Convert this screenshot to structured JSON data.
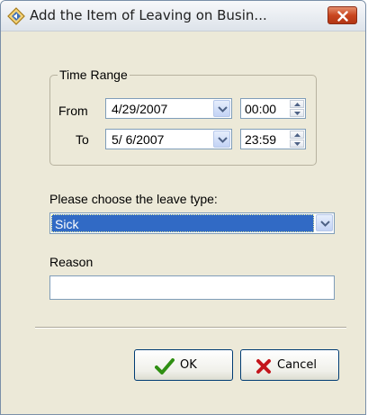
{
  "window": {
    "title": "Add the Item of Leaving on Busin..."
  },
  "time_range": {
    "legend": "Time Range",
    "from_label": "From",
    "to_label": "To",
    "from_date": "4/29/2007",
    "from_time": "00:00",
    "to_date": "5/ 6/2007",
    "to_time": "23:59"
  },
  "leave_type": {
    "label": "Please choose the leave type:",
    "selected": "Sick"
  },
  "reason": {
    "label": "Reason",
    "value": ""
  },
  "buttons": {
    "ok": "OK",
    "cancel": "Cancel"
  },
  "icons": {
    "app": "diamond-arrow-icon",
    "close": "close-x-icon",
    "ok": "checkmark-icon",
    "cancel": "red-x-icon"
  },
  "colors": {
    "selection": "#316ac5",
    "window_bg": "#ece9d8",
    "ok_check": "#2f8f12",
    "cancel_x": "#c4161c"
  }
}
